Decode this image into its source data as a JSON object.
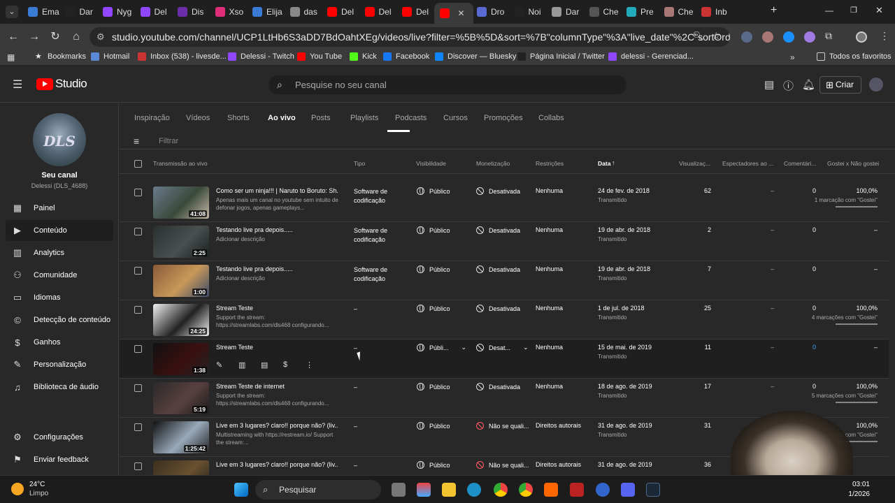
{
  "browser": {
    "tabs": [
      "Ema",
      "Dar",
      "Nyg",
      "Del",
      "Dis",
      "Xso",
      "Elija",
      "das",
      "Del",
      "Del",
      "Del",
      "",
      "Dro",
      "Noi",
      "Dar",
      "Che",
      "Pre",
      "Che",
      "Inb"
    ],
    "url": "studio.youtube.com/channel/UCP1LtHb6S3aDD7BdOahtXEg/videos/live?filter=%5B%5D&sort=%7B\"columnType\"%3A\"live_date\"%2C\"sortOrder\"%3A\"ASCEN...",
    "bookmarks": [
      "Bookmarks",
      "Hotmail",
      "Inbox (538) - livesde...",
      "Delessi - Twitch",
      "You Tube",
      "Kick",
      "Facebook",
      "Discover — Bluesky",
      "Página Inicial / Twitter",
      "delessi - Gerenciad..."
    ],
    "all_bookmarks": "Todos os favoritos"
  },
  "header": {
    "logo_text": "Studio",
    "search_placeholder": "Pesquise no seu canal",
    "create_label": "Criar"
  },
  "sidebar": {
    "channel_name": "Seu canal",
    "channel_handle": "Delessi (DLS_4688)",
    "avatar_text": "DLS",
    "items": [
      {
        "label": "Painel",
        "icon": "dashboard-icon"
      },
      {
        "label": "Conteúdo",
        "icon": "content-icon",
        "active": true
      },
      {
        "label": "Analytics",
        "icon": "analytics-icon"
      },
      {
        "label": "Comunidade",
        "icon": "community-icon"
      },
      {
        "label": "Idiomas",
        "icon": "languages-icon"
      },
      {
        "label": "Detecção de conteúdo",
        "icon": "copyright-icon"
      },
      {
        "label": "Ganhos",
        "icon": "earn-icon"
      },
      {
        "label": "Personalização",
        "icon": "customization-icon"
      },
      {
        "label": "Biblioteca de áudio",
        "icon": "audio-library-icon"
      }
    ],
    "settings_label": "Configurações",
    "feedback_label": "Enviar feedback"
  },
  "content_tabs": [
    "Inspiração",
    "Vídeos",
    "Shorts",
    "Ao vivo",
    "Posts",
    "Playlists",
    "Podcasts",
    "Cursos",
    "Promoções",
    "Collabs"
  ],
  "active_tab": "Ao vivo",
  "filter_placeholder": "Filtrar",
  "columns": [
    "Transmissão ao vivo",
    "Tipo",
    "Visibilidade",
    "Monetização",
    "Restrições",
    "Data",
    "Visualizaç...",
    "Espectadores ao ...",
    "Comentári...",
    "Gostei x Não gostei"
  ],
  "rows": [
    {
      "title": "Como ser um ninja!!! | Naruto to Boruto: Sh...",
      "desc": "Apenas mais um canal no youtube sem intuito de defonar jogos, apenas gameplays...",
      "duration": "41:08",
      "type": "Software de codificação",
      "visibility": "Público",
      "monetization": "Desativada",
      "restriction": "Nenhuma",
      "date": "24 de fev. de 2018",
      "date_sub": "Transmitido",
      "views": "62",
      "concurrent": "–",
      "comments": "0",
      "likes": "100,0%",
      "likes_sub": "1 marcação com \"Gostei\"",
      "thumb": [
        "#6a7a8a",
        "#3a4a3a",
        "#c8b8a8"
      ]
    },
    {
      "title": "Testando live pra depois.....",
      "desc": "Adicionar descrição",
      "duration": "2:25",
      "type": "Software de codificação",
      "visibility": "Público",
      "monetization": "Desativada",
      "restriction": "Nenhuma",
      "date": "19 de abr. de 2018",
      "date_sub": "Transmitido",
      "views": "2",
      "concurrent": "–",
      "comments": "0",
      "likes": "–",
      "likes_sub": "",
      "thumb": [
        "#2a3030",
        "#4a5050",
        "#1a2020"
      ]
    },
    {
      "title": "Testando live pra depois.....",
      "desc": "Adicionar descrição",
      "duration": "1:00",
      "type": "Software de codificação",
      "visibility": "Público",
      "monetization": "Desativada",
      "restriction": "Nenhuma",
      "date": "19 de abr. de 2018",
      "date_sub": "Transmitido",
      "views": "7",
      "concurrent": "–",
      "comments": "0",
      "likes": "–",
      "likes_sub": "",
      "thumb": [
        "#8a5a3a",
        "#c89858",
        "#3a4a6a"
      ]
    },
    {
      "title": "Stream Teste",
      "desc": "Support the stream: https://streamlabs.com/dls468 configurando...",
      "duration": "24:25",
      "type": "–",
      "visibility": "Público",
      "monetization": "Desativada",
      "restriction": "Nenhuma",
      "date": "1 de jul. de 2018",
      "date_sub": "Transmitido",
      "views": "25",
      "concurrent": "–",
      "comments": "0",
      "likes": "100,0%",
      "likes_sub": "4 marcações com \"Gostei\"",
      "thumb": [
        "#f0f0f0",
        "#222",
        "#f0f0f0"
      ]
    },
    {
      "title": "Stream Teste",
      "desc": "",
      "duration": "1:38",
      "type": "–",
      "visibility": "Públi...",
      "monetization": "Desat...",
      "restriction": "Nenhuma",
      "date": "15 de mai. de 2019",
      "date_sub": "Transmitido",
      "views": "11",
      "concurrent": "–",
      "comments": "0",
      "likes": "–",
      "likes_sub": "",
      "thumb": [
        "#111",
        "#3a1010",
        "#222"
      ]
    },
    {
      "title": "Stream Teste de internet",
      "desc": "Support the stream: https://streamlabs.com/dls468 configurando...",
      "duration": "5:19",
      "type": "–",
      "visibility": "Público",
      "monetization": "Desativada",
      "restriction": "Nenhuma",
      "date": "18 de ago. de 2019",
      "date_sub": "Transmitido",
      "views": "17",
      "concurrent": "–",
      "comments": "0",
      "likes": "100,0%",
      "likes_sub": "5 marcações com \"Gostei\"",
      "thumb": [
        "#2a2a2a",
        "#5a4040",
        "#1a1a1a"
      ]
    },
    {
      "title": "Live em 3 lugares? claro!! porque não? (liv...",
      "desc": "Multistreaming with https://restream.io/ Support the stream:...",
      "duration": "1:25:42",
      "type": "–",
      "visibility": "Público",
      "monetization": "Não se quali...",
      "restriction": "Direitos autorais",
      "date": "31 de ago. de 2019",
      "date_sub": "Transmitido",
      "views": "31",
      "concurrent": "–",
      "comments": "0",
      "likes": "100,0%",
      "likes_sub": "1 marcação com \"Gostei\"",
      "thumb": [
        "#111",
        "#9ab",
        "#222"
      ]
    },
    {
      "title": "Live em 3 lugares? claro!! porque não? (liv...",
      "desc": "",
      "duration": "",
      "type": "–",
      "visibility": "Público",
      "monetization": "Não se quali...",
      "restriction": "Direitos autorais",
      "date": "31 de ago. de 2019",
      "date_sub": "",
      "views": "36",
      "concurrent": "–",
      "comments": "",
      "likes": "",
      "likes_sub": "",
      "thumb": [
        "#3a3020",
        "#6a5030",
        "#222"
      ]
    }
  ],
  "taskbar": {
    "temperature": "24°C",
    "weather": "Limpo",
    "search": "Pesquisar",
    "time": "03:01",
    "date": "1/2026"
  }
}
